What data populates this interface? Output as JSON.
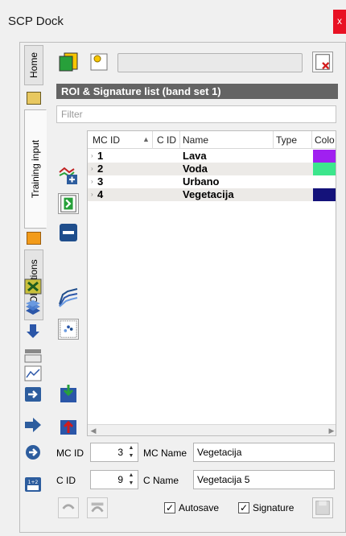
{
  "window": {
    "title": "SCP Dock",
    "close_label": "x"
  },
  "vertical_tabs": [
    {
      "label": "Home"
    },
    {
      "label": "Training input"
    },
    {
      "label": "ROI options"
    }
  ],
  "toolbar": {
    "combo_value": ""
  },
  "section": {
    "header": "ROI & Signature list (band set 1)"
  },
  "filter": {
    "placeholder": "Filter"
  },
  "table": {
    "columns": [
      "MC ID",
      "C ID",
      "Name",
      "Type",
      "Colo"
    ],
    "rows": [
      {
        "mc_id": "1",
        "c_id": "",
        "name": "Lava",
        "type": "",
        "color": "#a020f0"
      },
      {
        "mc_id": "2",
        "c_id": "",
        "name": "Voda",
        "type": "",
        "color": "#3ce68c"
      },
      {
        "mc_id": "3",
        "c_id": "",
        "name": "Urbano",
        "type": "",
        "color": "#ffffff"
      },
      {
        "mc_id": "4",
        "c_id": "",
        "name": "Vegetacija",
        "type": "",
        "color": "#14127a"
      }
    ]
  },
  "form": {
    "mc_id_label": "MC ID",
    "mc_id_value": "3",
    "mc_name_label": "MC Name",
    "mc_name_value": "Vegetacija",
    "c_id_label": "C ID",
    "c_id_value": "9",
    "c_name_label": "C Name",
    "c_name_value": "Vegetacija 5"
  },
  "options": {
    "autosave_label": "Autosave",
    "autosave_checked": true,
    "signature_label": "Signature",
    "signature_checked": true
  },
  "colors": {
    "header_bg": "#646464",
    "alt_row": "#eceae7",
    "close_red": "#e81123"
  }
}
